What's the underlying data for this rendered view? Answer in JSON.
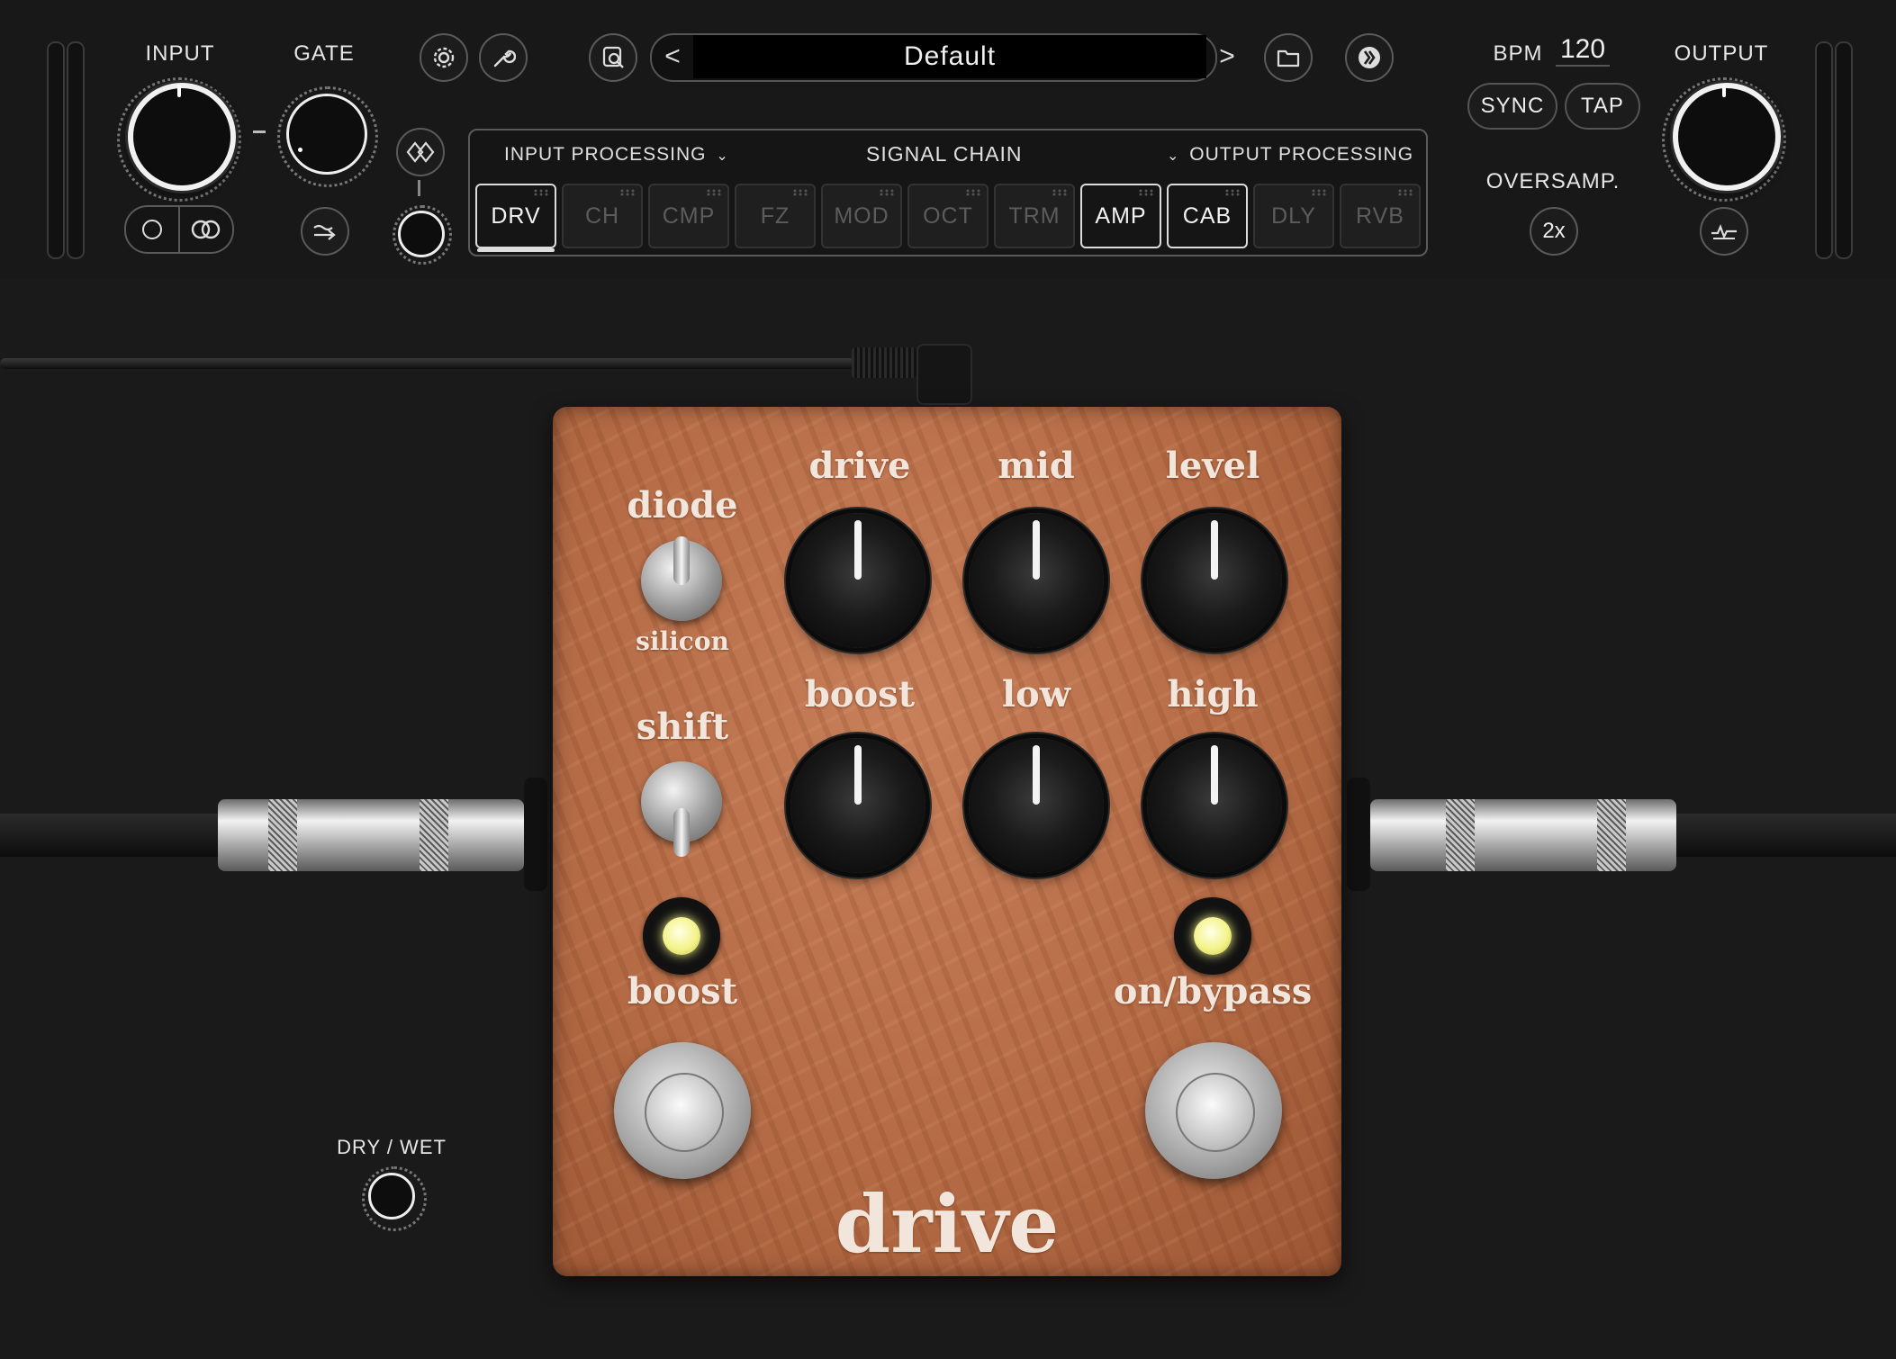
{
  "header": {
    "input_label": "INPUT",
    "gate_label": "GATE",
    "output_label": "OUTPUT",
    "bpm_label": "BPM",
    "bpm_value": "120",
    "sync_label": "SYNC",
    "tap_label": "TAP",
    "oversamp_label": "OVERSAMP.",
    "oversamp_value": "2x"
  },
  "preset": {
    "name": "Default",
    "prev_glyph": "<",
    "next_glyph": ">"
  },
  "signal_chain": {
    "title": "SIGNAL CHAIN",
    "input_processing": "INPUT PROCESSING",
    "output_processing": "OUTPUT PROCESSING",
    "slots": [
      {
        "label": "DRV",
        "active": true,
        "selected": true
      },
      {
        "label": "CH",
        "active": false
      },
      {
        "label": "CMP",
        "active": false
      },
      {
        "label": "FZ",
        "active": false
      },
      {
        "label": "MOD",
        "active": false
      },
      {
        "label": "OCT",
        "active": false
      },
      {
        "label": "TRM",
        "active": false
      },
      {
        "label": "AMP",
        "active": true
      },
      {
        "label": "CAB",
        "active": true
      },
      {
        "label": "DLY",
        "active": false
      },
      {
        "label": "RVB",
        "active": false
      }
    ]
  },
  "pedal": {
    "name": "drive",
    "diode_label": "diode",
    "silicon_label": "silicon",
    "shift_label": "shift",
    "boost_led_label": "boost",
    "bypass_label": "on/bypass",
    "knobs": {
      "drive": "drive",
      "mid": "mid",
      "level": "level",
      "boost": "boost",
      "low": "low",
      "high": "high"
    },
    "colors": {
      "body": "#b56c46",
      "led": "#f4f38a"
    }
  },
  "dry_wet_label": "DRY / WET"
}
